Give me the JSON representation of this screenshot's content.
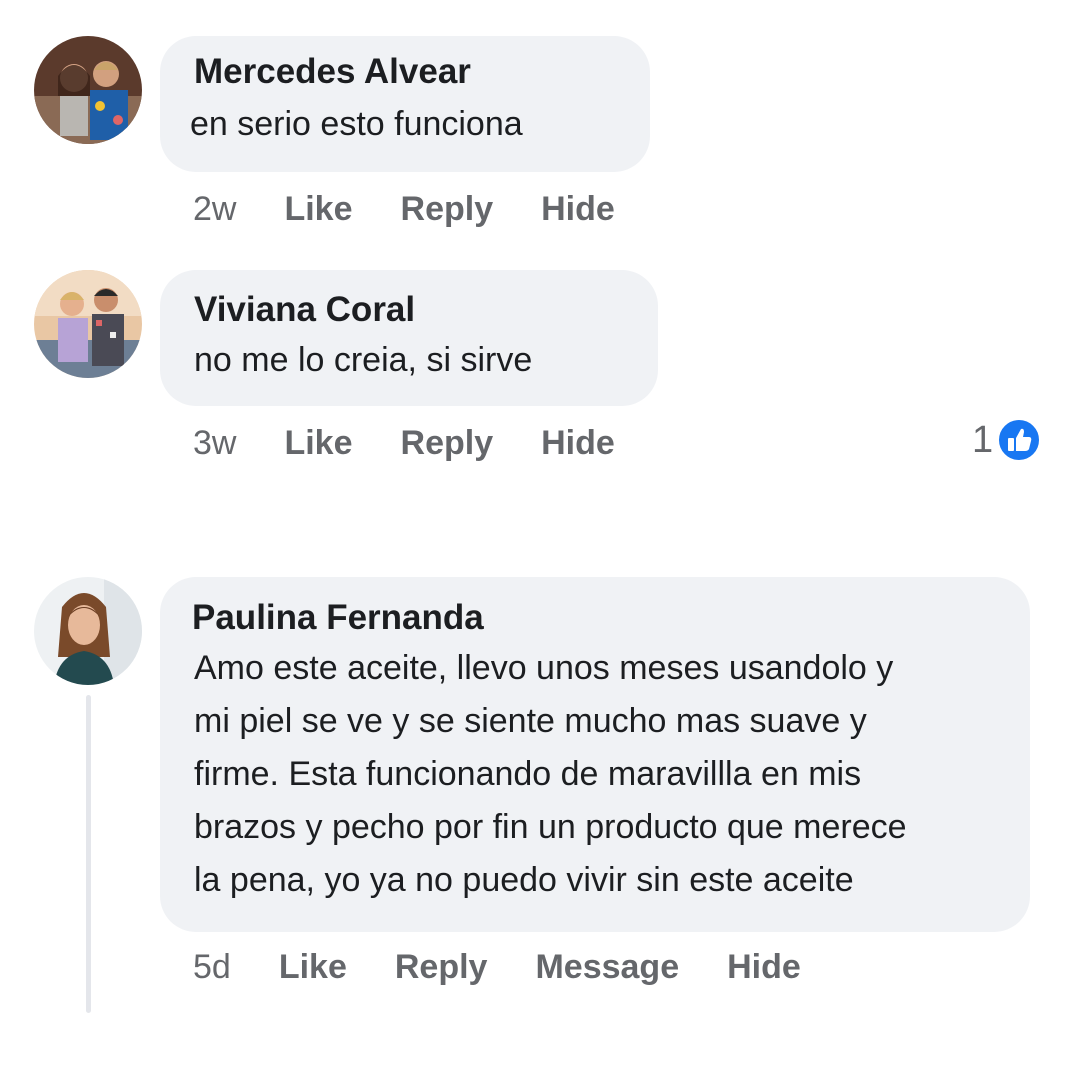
{
  "colors": {
    "bubble_bg": "#f0f2f5",
    "meta_text": "#65676b",
    "like_blue": "#1877f2"
  },
  "comments": [
    {
      "author": "Mercedes Alvear",
      "text": "en serio esto funciona",
      "time": "2w",
      "actions": [
        "Like",
        "Reply",
        "Hide"
      ],
      "avatar_icon": "avatar-photo"
    },
    {
      "author": "Viviana Coral",
      "text": "no me lo creia, si sirve",
      "time": "3w",
      "actions": [
        "Like",
        "Reply",
        "Hide"
      ],
      "avatar_icon": "avatar-photo",
      "reaction_count": "1",
      "reaction_icon": "like-icon"
    },
    {
      "author": "Paulina Fernanda",
      "text": "Amo este aceite, llevo unos meses usandolo y\nmi piel se ve y se siente mucho mas suave y\nfirme. Esta funcionando de maravillla en mis\nbrazos y pecho por fin un producto que merece\nla pena, yo ya no puedo vivir sin este aceite",
      "time": "5d",
      "actions": [
        "Like",
        "Reply",
        "Message",
        "Hide"
      ],
      "avatar_icon": "avatar-photo"
    }
  ]
}
